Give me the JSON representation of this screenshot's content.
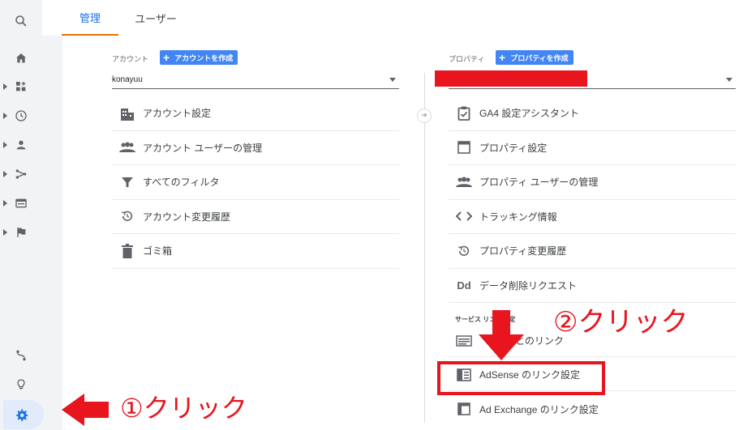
{
  "tabs": {
    "admin": "管理",
    "user": "ユーザー"
  },
  "account": {
    "label": "アカウント",
    "create_button": "アカウントを作成",
    "selected": "konayuu",
    "items": [
      {
        "icon": "building-icon",
        "label": "アカウント設定"
      },
      {
        "icon": "people-icon",
        "label": "アカウント ユーザーの管理"
      },
      {
        "icon": "filter-icon",
        "label": "すべてのフィルタ"
      },
      {
        "icon": "history-icon",
        "label": "アカウント変更履歴"
      },
      {
        "icon": "trash-icon",
        "label": "ゴミ箱"
      }
    ]
  },
  "property": {
    "label": "プロパティ",
    "create_button": "プロパティを作成",
    "selected": "",
    "items": [
      {
        "icon": "clipboard-check-icon",
        "label": "GA4 設定アシスタント"
      },
      {
        "icon": "window-icon",
        "label": "プロパティ設定"
      },
      {
        "icon": "people-icon",
        "label": "プロパティ ユーザーの管理"
      },
      {
        "icon": "code-icon",
        "label": "トラッキング情報"
      },
      {
        "icon": "history-icon",
        "label": "プロパティ変更履歴"
      },
      {
        "icon": "dd-icon",
        "label": "データ削除リクエスト"
      }
    ],
    "section_title": "サービス リンク設定",
    "links": [
      {
        "icon": "ads-icon",
        "label": "広告とのリンク"
      },
      {
        "icon": "adsense-icon",
        "label": "AdSense のリンク設定"
      },
      {
        "icon": "adexchange-icon",
        "label": "Ad Exchange のリンク設定"
      }
    ]
  },
  "annotations": {
    "step1": "①クリック",
    "step2": "②クリック",
    "color": "#e8141e"
  },
  "colors": {
    "accent": "#1a73e8",
    "tab_underline": "#e37400",
    "create_button": "#4285f4",
    "selected_rail": "#e1ebfb"
  }
}
